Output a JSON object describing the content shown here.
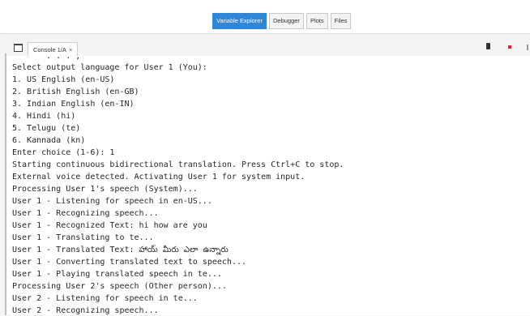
{
  "top_tabs": [
    {
      "label": "Variable Explorer",
      "active": true
    },
    {
      "label": "Debugger",
      "active": false
    },
    {
      "label": "Plots",
      "active": false
    },
    {
      "label": "Files",
      "active": false
    }
  ],
  "console": {
    "tab_label": "Console 1/A",
    "close_glyph": "×",
    "lines": [
      "       . . . ,",
      "Select output language for User 1 (You):",
      "1. US English (en-US)",
      "2. British English (en-GB)",
      "3. Indian English (en-IN)",
      "4. Hindi (hi)",
      "5. Telugu (te)",
      "6. Kannada (kn)",
      "Enter choice (1-6): 1",
      "Starting continuous bidirectional translation. Press Ctrl+C to stop.",
      "External voice detected. Activating User 1 for system input.",
      "Processing User 1's speech (System)...",
      "User 1 - Listening for speech in en-US...",
      "User 1 - Recognizing speech...",
      "User 1 - Recognized Text: hi how are you",
      "User 1 - Translating to te...",
      "User 1 - Translated Text: హాయ్ మీరు ఎలా ఉన్నారు",
      "User 1 - Converting translated text to speech...",
      "User 1 - Playing translated speech in te...",
      "Processing User 2's speech (Other person)...",
      "User 2 - Listening for speech in te...",
      "User 2 - Recognizing speech..."
    ]
  },
  "icons": {
    "window": "window-icon",
    "document": "document-icon",
    "stop": "stop-icon",
    "options": "options-icon"
  },
  "colors": {
    "active_tab": "#2f86d6",
    "stop": "#e0202a",
    "text": "#262626"
  }
}
